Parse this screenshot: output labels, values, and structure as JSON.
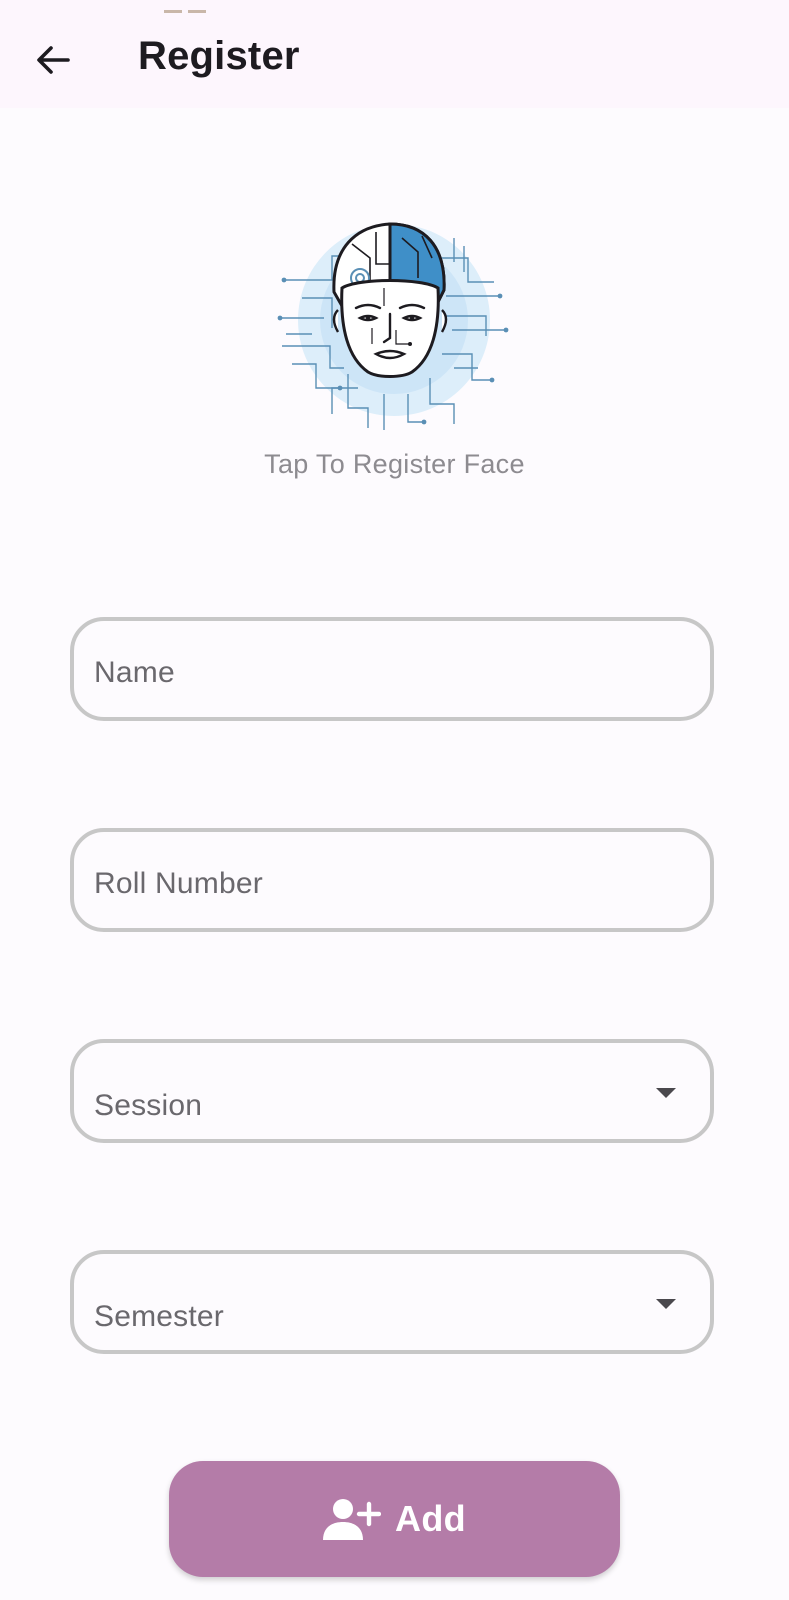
{
  "app_bar": {
    "title": "Register",
    "back_icon": "arrow-left-icon"
  },
  "face_register": {
    "caption": "Tap To Register Face",
    "icon": "face-circuit-illustration"
  },
  "form": {
    "name": {
      "placeholder": "Name"
    },
    "roll_number": {
      "placeholder": "Roll Number"
    },
    "session": {
      "label": "Session",
      "icon": "dropdown-caret-icon"
    },
    "semester": {
      "label": "Semester",
      "icon": "dropdown-caret-icon"
    }
  },
  "add_button": {
    "label": "Add",
    "icon": "person-add-icon"
  },
  "colors": {
    "app_bar_bg": "#fdf6fd",
    "page_bg": "#fdfbfe",
    "field_border": "#c7c7c7",
    "button_bg": "#b47ca8",
    "illustration_blue": "#3f8fc8"
  }
}
